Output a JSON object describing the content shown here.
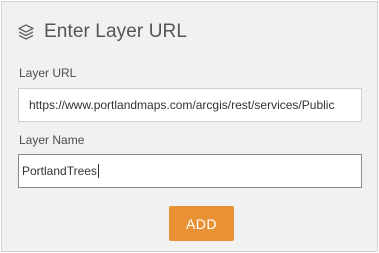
{
  "header": {
    "icon": "layers-icon",
    "title": "Enter Layer URL"
  },
  "layer_url": {
    "label": "Layer URL",
    "value": "https://www.portlandmaps.com/arcgis/rest/services/Public"
  },
  "layer_name": {
    "label": "Layer Name",
    "value": "PortlandTrees"
  },
  "actions": {
    "add_label": "ADD"
  },
  "colors": {
    "accent": "#e99235",
    "panel_background": "#f1f1f1"
  }
}
